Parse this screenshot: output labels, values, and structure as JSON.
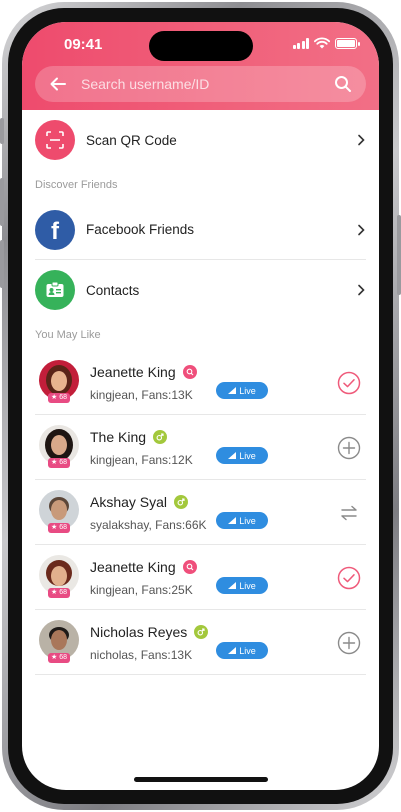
{
  "status_bar": {
    "time": "09:41"
  },
  "search": {
    "placeholder": "Search username/ID"
  },
  "scan": {
    "label": "Scan QR Code"
  },
  "discover": {
    "section_title": "Discover Friends",
    "items": [
      {
        "label": "Facebook Friends",
        "icon": "facebook-icon",
        "color": "#2f5ca6"
      },
      {
        "label": "Contacts",
        "icon": "contact-card-icon",
        "color": "#36b25a"
      }
    ]
  },
  "you_may_like": {
    "section_title": "You May Like",
    "users": [
      {
        "name": "Jeanette King",
        "username": "kingjean",
        "fans": "Fans:13K",
        "level": "68",
        "live": "Live",
        "tag": "search-tag",
        "action": "followed-check"
      },
      {
        "name": "The King",
        "username": "kingjean",
        "fans": "Fans:12K",
        "level": "68",
        "live": "Live",
        "tag": "male-tag",
        "action": "follow-add"
      },
      {
        "name": "Akshay Syal",
        "username": "syalakshay",
        "fans": "Fans:66K",
        "level": "68",
        "live": "Live",
        "tag": "male-tag",
        "action": "mutual-follow"
      },
      {
        "name": "Jeanette King",
        "username": "kingjean",
        "fans": "Fans:25K",
        "level": "68",
        "live": "Live",
        "tag": "search-tag",
        "action": "followed-check"
      },
      {
        "name": "Nicholas Reyes",
        "username": "nicholas",
        "fans": "Fans:13K",
        "level": "68",
        "live": "Live",
        "tag": "male-tag",
        "action": "follow-add"
      }
    ]
  },
  "colors": {
    "accent": "#ee4b6d",
    "live": "#2f8de0",
    "male_tag": "#a3c83c",
    "search_tag": "#ef4f7b",
    "level_badge": "#e84b83"
  }
}
